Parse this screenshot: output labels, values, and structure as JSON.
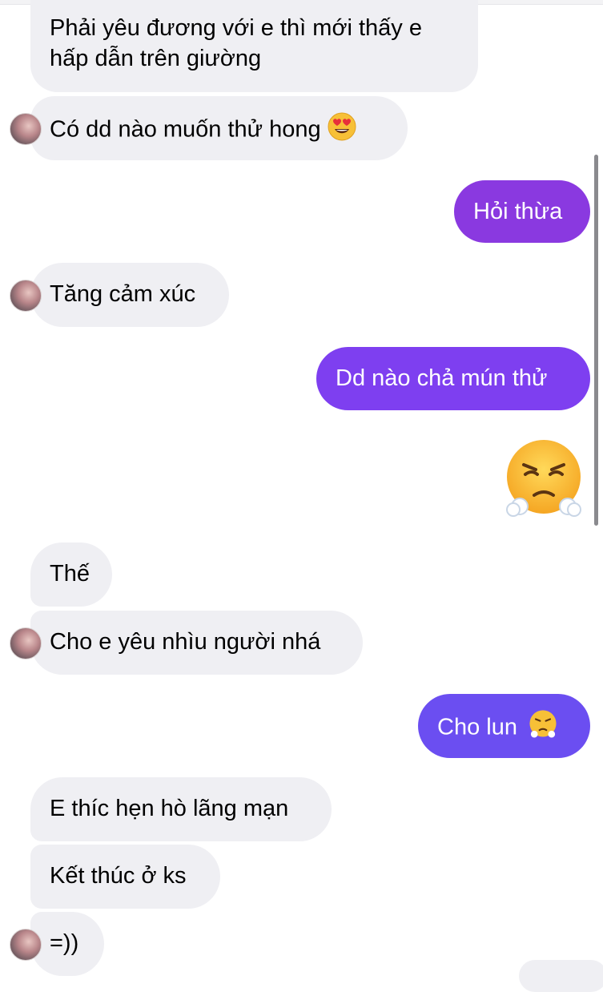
{
  "messages": [
    {
      "text": "Phải yêu đương với e thì mới thấy e hấp dẫn trên giường"
    },
    {
      "text": "Có dd nào muốn thử hong",
      "emoji": "heart-eyes-icon"
    },
    {
      "text": "Hỏi thừa"
    },
    {
      "text": "Tăng cảm xúc"
    },
    {
      "text": "Dd nào chả mún thử"
    },
    {
      "emoji": "face-with-steam-from-nose-icon"
    },
    {
      "text": "Thế"
    },
    {
      "text": "Cho e yêu nhìu người nhá"
    },
    {
      "text": "Cho lun",
      "emoji": "face-with-steam-from-nose-icon"
    },
    {
      "text": "E thíc hẹn hò lãng mạn"
    },
    {
      "text": "Kết thúc ở ks"
    },
    {
      "text": "=))"
    }
  ],
  "colors": {
    "incoming_bubble": "#efeff3",
    "outgoing_purple_1": "#8a39e0",
    "outgoing_purple_2": "#7e3ff0",
    "outgoing_purple_3": "#6b4ef1"
  }
}
